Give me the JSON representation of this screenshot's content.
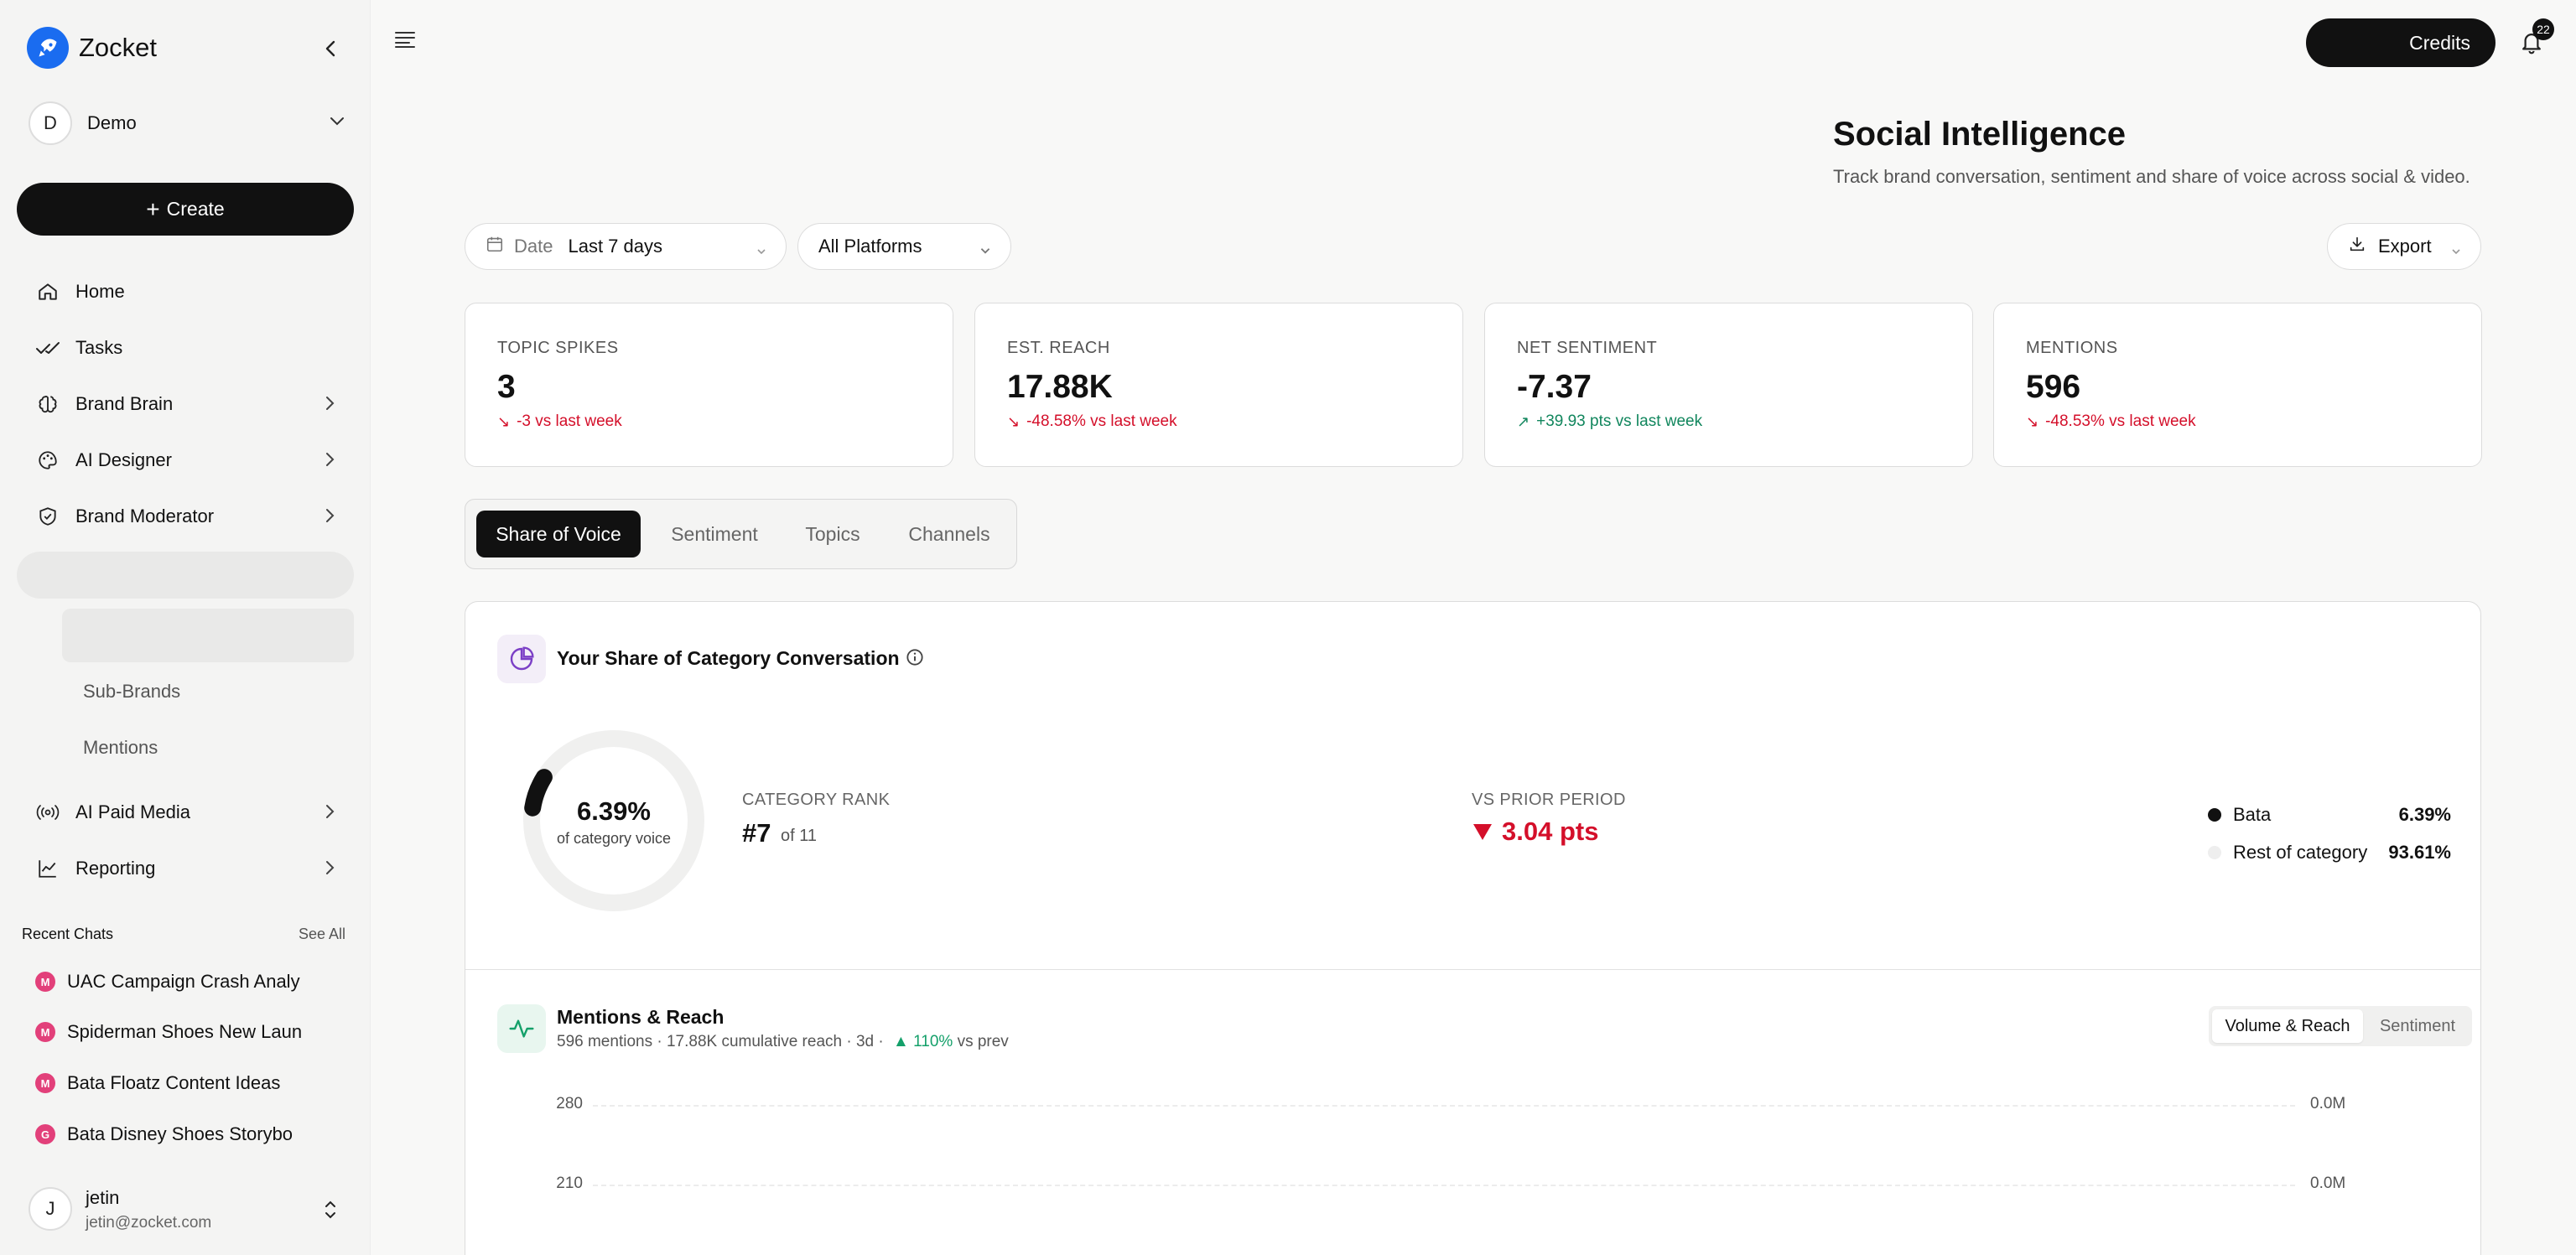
{
  "app": {
    "name": "Zocket",
    "accent": "#1a6cf0"
  },
  "workspace": {
    "initial": "D",
    "name": "Demo"
  },
  "sidebar": {
    "create_label": "Create",
    "items": [
      {
        "label": "Home",
        "icon": "home-icon"
      },
      {
        "label": "Tasks",
        "icon": "check-icon"
      },
      {
        "label": "Brand Brain",
        "icon": "brain-icon"
      },
      {
        "label": "AI Designer",
        "icon": "palette-icon"
      },
      {
        "label": "Brand Moderator",
        "icon": "shield-icon"
      }
    ],
    "sub_items": [
      "Sub-Brands",
      "Mentions"
    ],
    "items_lower": [
      {
        "label": "AI Paid Media",
        "icon": "broadcast-icon"
      },
      {
        "label": "Reporting",
        "icon": "chart-line-icon"
      }
    ],
    "recent_title": "Recent Chats",
    "see_all": "See All",
    "chats": [
      {
        "badge": "M",
        "title": "UAC Campaign Crash Analy"
      },
      {
        "badge": "M",
        "title": "Spiderman Shoes New Laun"
      },
      {
        "badge": "M",
        "title": "Bata Floatz Content Ideas"
      },
      {
        "badge": "G",
        "title": "Bata Disney Shoes Storybo"
      }
    ],
    "user": {
      "initial": "J",
      "name": "jetin",
      "email": "jetin@zocket.com"
    }
  },
  "topbar": {
    "credits_label": "Credits",
    "notifications": "22"
  },
  "header": {
    "title": "Social Intelligence",
    "subtitle": "Track brand conversation, sentiment and share of voice across social & video."
  },
  "filters": {
    "date_label": "Date",
    "date_value": "Last 7 days",
    "platform_value": "All Platforms",
    "export_label": "Export"
  },
  "kpis": [
    {
      "label": "TOPIC SPIKES",
      "value": "3",
      "change": "-3 vs last week",
      "direction": "down"
    },
    {
      "label": "EST. REACH",
      "value": "17.88K",
      "change": "-48.58% vs last week",
      "direction": "down"
    },
    {
      "label": "NET SENTIMENT",
      "value": "-7.37",
      "change": "+39.93 pts vs last week",
      "direction": "up"
    },
    {
      "label": "MENTIONS",
      "value": "596",
      "change": "-48.53% vs last week",
      "direction": "down"
    }
  ],
  "tabs": [
    "Share of Voice",
    "Sentiment",
    "Topics",
    "Channels"
  ],
  "active_tab": 0,
  "share": {
    "title": "Your Share of Category Conversation",
    "share_pct": 6.39,
    "donut_value": "6.39%",
    "donut_sub": "of category voice",
    "rank_label": "CATEGORY RANK",
    "rank_value": "#7",
    "rank_of": "of 11",
    "prior_label": "VS PRIOR PERIOD",
    "prior_value": "3.04 pts",
    "legend": [
      {
        "name": "Bata",
        "pct": "6.39%",
        "color": "#111111"
      },
      {
        "name": "Rest of category",
        "pct": "93.61%",
        "color": "#eeeeee"
      }
    ]
  },
  "mentions_reach": {
    "title": "Mentions & Reach",
    "sub_prefix": "596 mentions · 17.88K cumulative reach · 3d ·",
    "growth": "110%",
    "sub_suffix": "vs prev",
    "toggle": [
      "Volume & Reach",
      "Sentiment"
    ],
    "y_left": [
      "280",
      "210"
    ],
    "y_right": [
      "0.0M",
      "0.0M"
    ]
  }
}
